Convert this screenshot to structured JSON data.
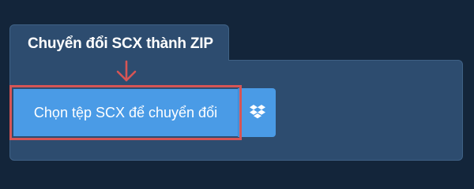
{
  "tab": {
    "title": "Chuyển đổi SCX thành ZIP"
  },
  "upload": {
    "choose_label": "Chọn tệp SCX để chuyển đổi",
    "dropbox_icon": "dropbox-icon"
  },
  "annotation": {
    "arrow_icon": "arrow-down-icon",
    "highlight_color": "#d65555"
  },
  "colors": {
    "background": "#13253a",
    "panel": "#2d4c6f",
    "button": "#4a9be6",
    "text": "#ffffff"
  }
}
